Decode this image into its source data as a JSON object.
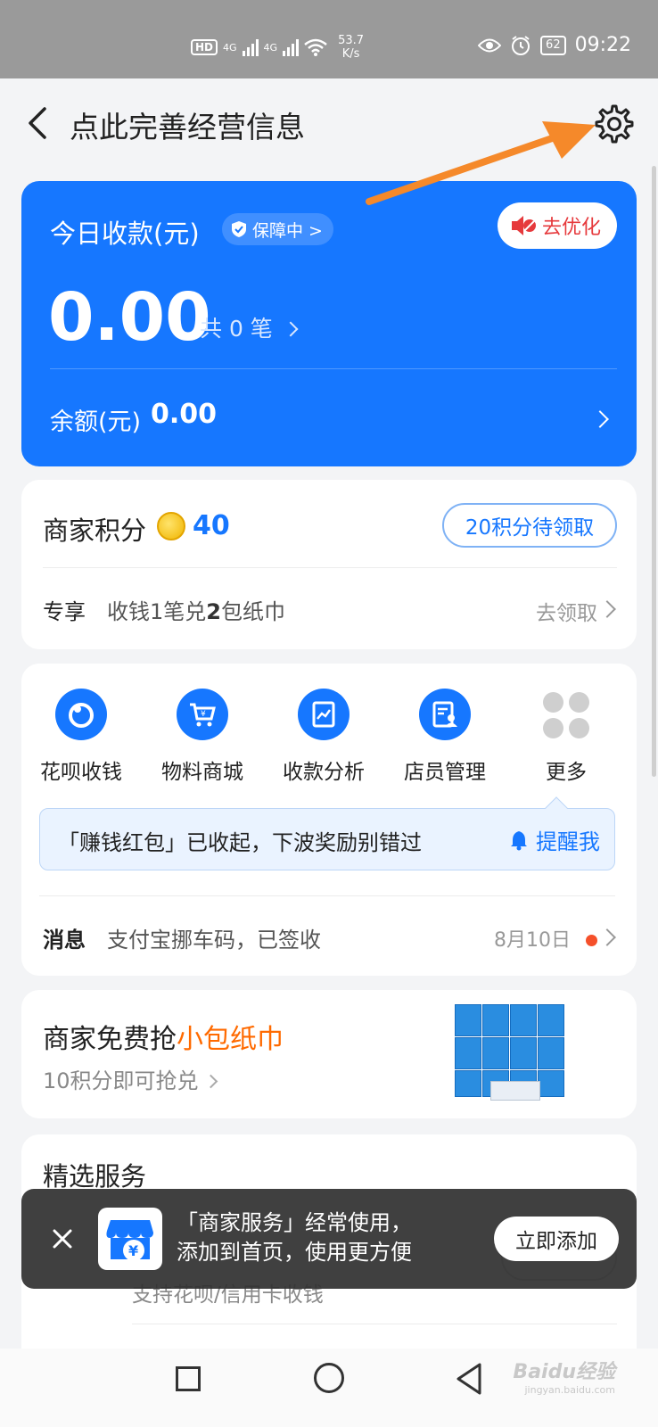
{
  "status_bar": {
    "network_a": "4G",
    "network_b": "4G",
    "speed": "53.7",
    "speed_unit": "K/s",
    "battery": "62",
    "time": "09:22"
  },
  "header": {
    "title": "点此完善经营信息"
  },
  "today": {
    "label": "今日收款(元)",
    "protect_label": "保障中 >",
    "optimize_label": "去优化",
    "amount": "0.00",
    "count_text": "共 0 笔",
    "balance_label": "余额(元)",
    "balance_value": "0.00"
  },
  "points": {
    "label": "商家积分",
    "value": "40",
    "claim_label": "20积分待领取",
    "exclusive_label": "专享",
    "exclusive_text_a": "收钱1笔兑",
    "exclusive_text_b": "2",
    "exclusive_text_c": "包纸巾",
    "exclusive_action": "去领取"
  },
  "services": {
    "items": [
      {
        "label": "花呗收钱",
        "icon": "huabei-icon"
      },
      {
        "label": "物料商城",
        "icon": "cart-icon"
      },
      {
        "label": "收款分析",
        "icon": "chart-icon"
      },
      {
        "label": "店员管理",
        "icon": "staff-icon"
      },
      {
        "label": "更多",
        "icon": "more-icon"
      }
    ],
    "tip_text": "「赚钱红包」已收起，下波奖励别错过",
    "tip_action": "提醒我",
    "message_label": "消息",
    "message_text": "支付宝挪车码，已签收",
    "message_date": "8月10日"
  },
  "promo": {
    "title_a": "商家免费抢",
    "title_b": "小包纸巾",
    "subtitle": "10积分即可抢兑"
  },
  "selected": {
    "title": "精选服务",
    "subtitle": "支持花呗/信用卡收钱"
  },
  "toast": {
    "line1": "「商家服务」经常使用，",
    "line2": "添加到首页，使用更方便",
    "button": "立即添加"
  },
  "watermark": {
    "text": "Baidu经验",
    "sub": "jingyan.baidu.com"
  },
  "colors": {
    "primary": "#1677ff",
    "accent_orange": "#ff6a00",
    "red": "#e6393c",
    "arrow": "#f5892a"
  }
}
